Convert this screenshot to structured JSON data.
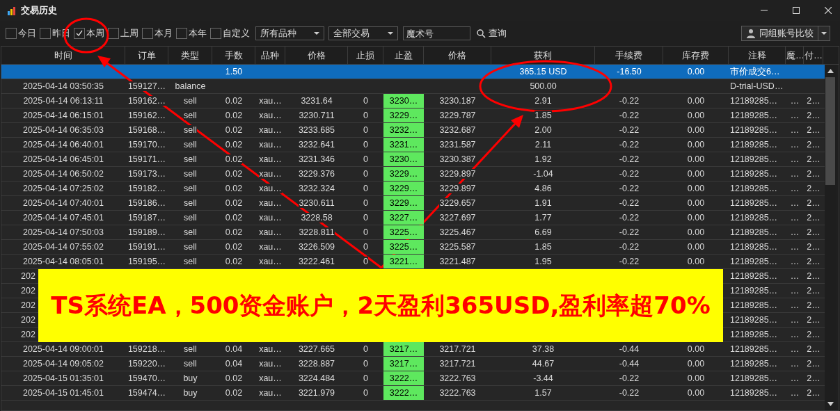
{
  "window": {
    "title": "交易历史"
  },
  "filters": [
    {
      "label": "今日",
      "checked": false
    },
    {
      "label": "昨日",
      "checked": false
    },
    {
      "label": "本周",
      "checked": true
    },
    {
      "label": "上周",
      "checked": false
    },
    {
      "label": "本月",
      "checked": false
    },
    {
      "label": "本年",
      "checked": false
    },
    {
      "label": "自定义",
      "checked": false
    }
  ],
  "symbol_select": {
    "value": "所有品种"
  },
  "deal_select": {
    "value": "全部交易"
  },
  "magic_field": {
    "placeholder": "魔术号"
  },
  "query_button": {
    "label": "查询"
  },
  "compare_button": {
    "label": "同组账号比较"
  },
  "table": {
    "columns": [
      "时间",
      "订单",
      "类型",
      "手数",
      "品种",
      "价格",
      "止损",
      "止盈",
      "价格",
      "获利",
      "手续费",
      "库存费",
      "注释",
      "魔…",
      "付…"
    ],
    "rows": [
      {
        "kind": "summary",
        "cells": [
          "",
          "",
          "",
          "1.50",
          "",
          "",
          "",
          "",
          "",
          "365.15 USD",
          "-16.50",
          "0.00",
          "市价成交6…"
        ]
      },
      {
        "kind": "balance",
        "cells": [
          "2025-04-14 03:50:35",
          "159127…",
          "balance",
          "",
          "",
          "",
          "",
          "",
          "",
          "500.00",
          "",
          "",
          "D-trial-USD…"
        ]
      },
      {
        "kind": "trade",
        "cells": [
          "2025-04-14 06:13:11",
          "159162…",
          "sell",
          "0.02",
          "xau…",
          "3231.64",
          "0",
          "3230…",
          "3230.187",
          "2.91",
          "-0.22",
          "0.00",
          "12189285…",
          "…",
          "2…"
        ]
      },
      {
        "kind": "trade",
        "cells": [
          "2025-04-14 06:15:01",
          "159162…",
          "sell",
          "0.02",
          "xau…",
          "3230.711",
          "0",
          "3229…",
          "3229.787",
          "1.85",
          "-0.22",
          "0.00",
          "12189285…",
          "…",
          "2…"
        ]
      },
      {
        "kind": "trade",
        "cells": [
          "2025-04-14 06:35:03",
          "159168…",
          "sell",
          "0.02",
          "xau…",
          "3233.685",
          "0",
          "3232…",
          "3232.687",
          "2.00",
          "-0.22",
          "0.00",
          "12189285…",
          "…",
          "2…"
        ]
      },
      {
        "kind": "trade",
        "cells": [
          "2025-04-14 06:40:01",
          "159170…",
          "sell",
          "0.02",
          "xau…",
          "3232.641",
          "0",
          "3231…",
          "3231.587",
          "2.11",
          "-0.22",
          "0.00",
          "12189285…",
          "…",
          "2…"
        ]
      },
      {
        "kind": "trade",
        "cells": [
          "2025-04-14 06:45:01",
          "159171…",
          "sell",
          "0.02",
          "xau…",
          "3231.346",
          "0",
          "3230…",
          "3230.387",
          "1.92",
          "-0.22",
          "0.00",
          "12189285…",
          "…",
          "2…"
        ]
      },
      {
        "kind": "trade",
        "cells": [
          "2025-04-14 06:50:02",
          "159173…",
          "sell",
          "0.02",
          "xau…",
          "3229.376",
          "0",
          "3229…",
          "3229.897",
          "-1.04",
          "-0.22",
          "0.00",
          "12189285…",
          "…",
          "2…"
        ]
      },
      {
        "kind": "trade",
        "cells": [
          "2025-04-14 07:25:02",
          "159182…",
          "sell",
          "0.02",
          "xau…",
          "3232.324",
          "0",
          "3229…",
          "3229.897",
          "4.86",
          "-0.22",
          "0.00",
          "12189285…",
          "…",
          "2…"
        ]
      },
      {
        "kind": "trade",
        "cells": [
          "2025-04-14 07:40:01",
          "159186…",
          "sell",
          "0.02",
          "xau…",
          "3230.611",
          "0",
          "3229…",
          "3229.657",
          "1.91",
          "-0.22",
          "0.00",
          "12189285…",
          "…",
          "2…"
        ]
      },
      {
        "kind": "trade",
        "cells": [
          "2025-04-14 07:45:01",
          "159187…",
          "sell",
          "0.02",
          "xau…",
          "3228.58",
          "0",
          "3227…",
          "3227.697",
          "1.77",
          "-0.22",
          "0.00",
          "12189285…",
          "…",
          "2…"
        ]
      },
      {
        "kind": "trade",
        "cells": [
          "2025-04-14 07:50:03",
          "159189…",
          "sell",
          "0.02",
          "xau…",
          "3228.811",
          "0",
          "3225…",
          "3225.467",
          "6.69",
          "-0.22",
          "0.00",
          "12189285…",
          "…",
          "2…"
        ]
      },
      {
        "kind": "trade",
        "cells": [
          "2025-04-14 07:55:02",
          "159191…",
          "sell",
          "0.02",
          "xau…",
          "3226.509",
          "0",
          "3225…",
          "3225.587",
          "1.85",
          "-0.22",
          "0.00",
          "12189285…",
          "…",
          "2…"
        ]
      },
      {
        "kind": "trade",
        "cells": [
          "2025-04-14 08:05:01",
          "159195…",
          "sell",
          "0.02",
          "xau…",
          "3222.461",
          "0",
          "3221…",
          "3221.487",
          "1.95",
          "-0.22",
          "0.00",
          "12189285…",
          "…",
          "2…"
        ]
      },
      {
        "kind": "covered",
        "cells": [
          "202",
          "",
          "",
          "",
          "",
          "",
          "",
          "",
          "",
          "",
          "",
          "",
          "12189285…",
          "…",
          "2…"
        ]
      },
      {
        "kind": "covered",
        "cells": [
          "202",
          "",
          "",
          "",
          "",
          "",
          "",
          "",
          "",
          "",
          "",
          "",
          "12189285…",
          "…",
          "2…"
        ]
      },
      {
        "kind": "covered",
        "cells": [
          "202",
          "",
          "",
          "",
          "",
          "",
          "",
          "",
          "",
          "",
          "",
          "",
          "12189285…",
          "…",
          "2…"
        ]
      },
      {
        "kind": "covered",
        "cells": [
          "202",
          "",
          "",
          "",
          "",
          "",
          "",
          "",
          "",
          "",
          "",
          "",
          "12189285…",
          "…",
          "2…"
        ]
      },
      {
        "kind": "covered",
        "cells": [
          "202",
          "",
          "",
          "",
          "",
          "",
          "",
          "",
          "",
          "",
          "",
          "",
          "12189285…",
          "…",
          "2…"
        ]
      },
      {
        "kind": "trade",
        "cells": [
          "2025-04-14 09:00:01",
          "159218…",
          "sell",
          "0.04",
          "xau…",
          "3227.665",
          "0",
          "3217…",
          "3217.721",
          "37.38",
          "-0.44",
          "0.00",
          "12189285…",
          "…",
          "2…"
        ]
      },
      {
        "kind": "trade",
        "cells": [
          "2025-04-14 09:05:02",
          "159220…",
          "sell",
          "0.04",
          "xau…",
          "3228.887",
          "0",
          "3217…",
          "3217.721",
          "44.67",
          "-0.44",
          "0.00",
          "12189285…",
          "…",
          "2…"
        ]
      },
      {
        "kind": "trade",
        "cells": [
          "2025-04-15 01:35:01",
          "159470…",
          "buy",
          "0.02",
          "xau…",
          "3224.484",
          "0",
          "3222…",
          "3222.763",
          "-3.44",
          "-0.22",
          "0.00",
          "12189285…",
          "…",
          "2…"
        ]
      },
      {
        "kind": "trade",
        "cells": [
          "2025-04-15 01:45:01",
          "159474…",
          "buy",
          "0.02",
          "xau…",
          "3221.979",
          "0",
          "3222…",
          "3222.763",
          "1.57",
          "-0.22",
          "0.00",
          "12189285…",
          "…",
          "2…"
        ]
      }
    ]
  },
  "banner": {
    "text": "TS系统EA，500资金账户，2天盈利365USD,盈利率超70%"
  }
}
